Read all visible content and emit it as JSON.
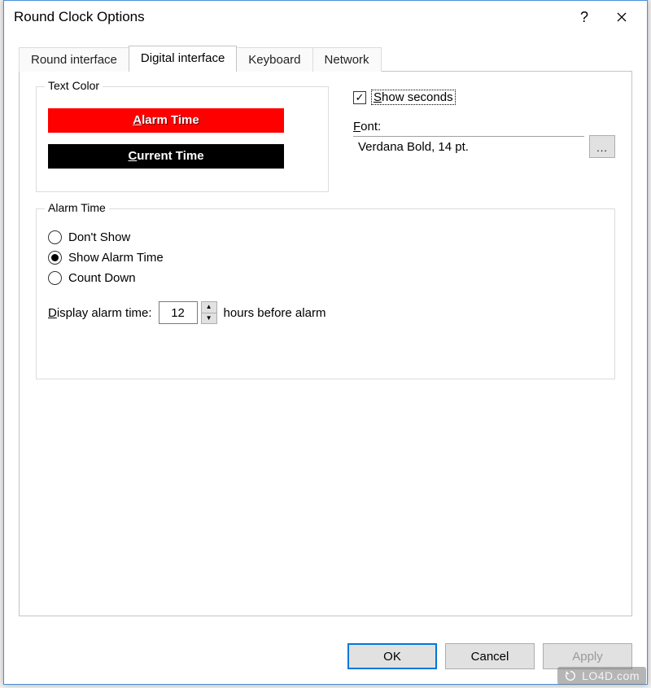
{
  "window": {
    "title": "Round Clock Options"
  },
  "tabs": {
    "round": "Round interface",
    "digital": "Digital interface",
    "keyboard": "Keyboard",
    "network": "Network"
  },
  "textcolor": {
    "legend": "Text Color",
    "alarm_prefix_u": "A",
    "alarm_rest": "larm Time",
    "current_prefix_u": "C",
    "current_rest": "urrent Time"
  },
  "show_seconds": {
    "label_u": "S",
    "label_rest": "how seconds",
    "checked": true
  },
  "font": {
    "label_u": "F",
    "label_rest": "ont:",
    "value": "Verdana Bold, 14 pt.",
    "button": "..."
  },
  "alarm": {
    "legend": "Alarm Time",
    "opt1": "Don't Show",
    "opt2": "Show Alarm Time",
    "opt3": "Count Down",
    "display_u": "D",
    "display_rest": "isplay alarm time:",
    "value": "12",
    "suffix": "hours before alarm"
  },
  "buttons": {
    "ok": "OK",
    "cancel": "Cancel",
    "apply": "Apply"
  },
  "watermark": "LO4D.com"
}
